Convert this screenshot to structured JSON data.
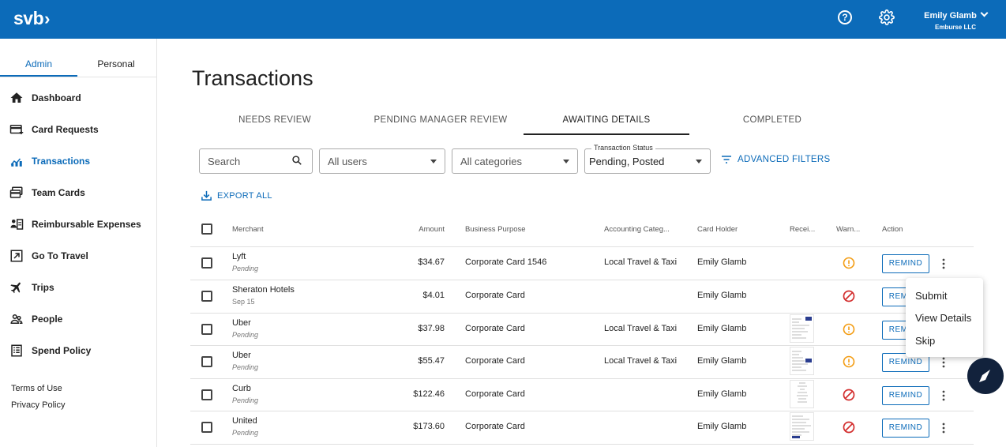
{
  "header": {
    "logo_text": "svb",
    "user_name": "Emily Glamb",
    "user_org": "Emburse LLC"
  },
  "sidebar": {
    "tabs": [
      {
        "label": "Admin",
        "active": true
      },
      {
        "label": "Personal",
        "active": false
      }
    ],
    "items": [
      {
        "label": "Dashboard",
        "icon": "home-icon"
      },
      {
        "label": "Card Requests",
        "icon": "card-request-icon"
      },
      {
        "label": "Transactions",
        "icon": "transactions-icon",
        "active": true
      },
      {
        "label": "Team Cards",
        "icon": "team-cards-icon"
      },
      {
        "label": "Reimbursable Expenses",
        "icon": "reimbursable-icon"
      },
      {
        "label": "Go To Travel",
        "icon": "external-link-icon"
      },
      {
        "label": "Trips",
        "icon": "plane-icon"
      },
      {
        "label": "People",
        "icon": "people-icon"
      },
      {
        "label": "Spend Policy",
        "icon": "policy-icon"
      }
    ],
    "footer": [
      "Terms of Use",
      "Privacy Policy"
    ]
  },
  "main": {
    "title": "Transactions",
    "tabs": [
      {
        "label": "NEEDS REVIEW",
        "active": false
      },
      {
        "label": "PENDING MANAGER REVIEW",
        "active": false
      },
      {
        "label": "AWAITING DETAILS",
        "active": true
      },
      {
        "label": "COMPLETED",
        "active": false
      }
    ],
    "filters": {
      "search_placeholder": "Search",
      "users_value": "All users",
      "categories_value": "All categories",
      "status_label": "Transaction Status",
      "status_value": "Pending, Posted",
      "advanced_label": "ADVANCED FILTERS"
    },
    "export_label": "EXPORT ALL"
  },
  "table": {
    "headers": [
      "Merchant",
      "Amount",
      "Business Purpose",
      "Accounting Categ...",
      "Card Holder",
      "Recei...",
      "Warn...",
      "Action"
    ],
    "rows": [
      {
        "merchant": "Lyft",
        "sub": "Pending",
        "amount": "$34.67",
        "purpose": "Corporate Card 1546",
        "category": "Local Travel & Taxi",
        "holder": "Emily Glamb",
        "receipt": false,
        "warning": "alert",
        "action": "REMIND"
      },
      {
        "merchant": "Sheraton Hotels",
        "sub": "Sep 15",
        "amount": "$4.01",
        "purpose": "Corporate Card",
        "category": "",
        "holder": "Emily Glamb",
        "receipt": false,
        "warning": "blocked",
        "action": "REMIND"
      },
      {
        "merchant": "Uber",
        "sub": "Pending",
        "amount": "$37.98",
        "purpose": "Corporate Card",
        "category": "Local Travel & Taxi",
        "holder": "Emily Glamb",
        "receipt": true,
        "warning": "alert",
        "action": "REMIND"
      },
      {
        "merchant": "Uber",
        "sub": "Pending",
        "amount": "$55.47",
        "purpose": "Corporate Card",
        "category": "Local Travel & Taxi",
        "holder": "Emily Glamb",
        "receipt": true,
        "warning": "alert",
        "action": "REMIND"
      },
      {
        "merchant": "Curb",
        "sub": "Pending",
        "amount": "$122.46",
        "purpose": "Corporate Card",
        "category": "",
        "holder": "Emily Glamb",
        "receipt": true,
        "warning": "blocked",
        "action": "REMIND"
      },
      {
        "merchant": "United",
        "sub": "Pending",
        "amount": "$173.60",
        "purpose": "Corporate Card",
        "category": "",
        "holder": "Emily Glamb",
        "receipt": true,
        "warning": "blocked",
        "action": "REMIND"
      }
    ]
  },
  "context_menu": {
    "items": [
      "Submit",
      "View Details",
      "Skip"
    ]
  },
  "colors": {
    "brand": "#0c6bb9",
    "warning_orange": "#f39c12",
    "blocked_red": "#d32f2f",
    "chat_bg": "#12223c"
  }
}
